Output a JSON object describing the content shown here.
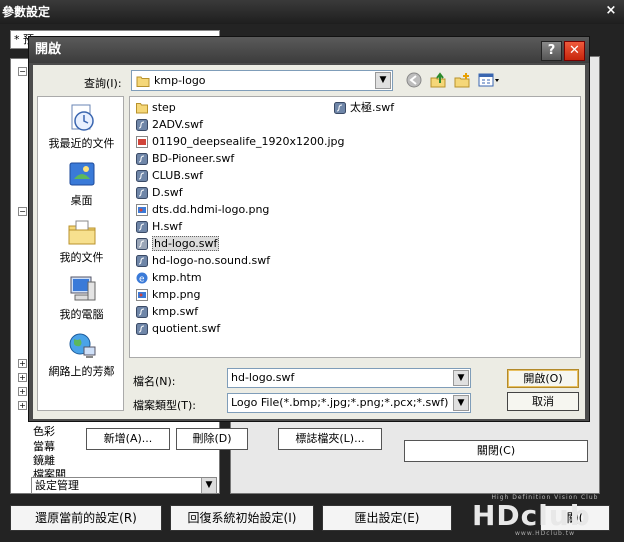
{
  "settings_window": {
    "title": "參數設定",
    "close_glyph": "×",
    "preset_value": "* 預",
    "tree_items": [
      "色彩",
      "當幕",
      "鏡離",
      "檔案關"
    ],
    "tree_combo_value": "設定管理",
    "buttons": {
      "add": "新增(A)...",
      "delete": "刪除(D)",
      "logo_folder": "標誌檔夾(L)...",
      "close": "關閉(C)",
      "restore_current": "還原當前的設定(R)",
      "restore_default": "回復系統初始設定(I)",
      "export": "匯出設定(E)",
      "partial": "關("
    }
  },
  "watermark": {
    "sub": "High Definition Vision Club",
    "big": "HDclub",
    "url": "www.HDclub.tw"
  },
  "open_dialog": {
    "title": "開啟",
    "help_glyph": "?",
    "close_glyph": "✕",
    "look_in_label": "查詢(I):",
    "look_in_value": "kmp-logo",
    "places": [
      {
        "label": "我最近的文件",
        "icon": "recent-documents-icon"
      },
      {
        "label": "桌面",
        "icon": "desktop-icon"
      },
      {
        "label": "我的文件",
        "icon": "my-documents-icon"
      },
      {
        "label": "我的電腦",
        "icon": "my-computer-icon"
      },
      {
        "label": "網路上的芳鄰",
        "icon": "network-places-icon"
      }
    ],
    "files_col1": [
      {
        "name": "step",
        "type": "folder"
      },
      {
        "name": "2ADV.swf",
        "type": "swf"
      },
      {
        "name": "01190_deepsealife_1920x1200.jpg",
        "type": "image"
      },
      {
        "name": "BD-Pioneer.swf",
        "type": "swf"
      },
      {
        "name": "CLUB.swf",
        "type": "swf"
      },
      {
        "name": "D.swf",
        "type": "swf"
      },
      {
        "name": "dts.dd.hdmi-logo.png",
        "type": "image"
      },
      {
        "name": "H.swf",
        "type": "swf"
      },
      {
        "name": "hd-logo.swf",
        "type": "swf",
        "selected": true
      },
      {
        "name": "hd-logo-no.sound.swf",
        "type": "swf"
      },
      {
        "name": "kmp.htm",
        "type": "html"
      },
      {
        "name": "kmp.png",
        "type": "image"
      },
      {
        "name": "kmp.swf",
        "type": "swf"
      },
      {
        "name": "quotient.swf",
        "type": "swf"
      }
    ],
    "files_col2": [
      {
        "name": "太極.swf",
        "type": "swf"
      }
    ],
    "filename_label": "檔名(N):",
    "filename_value": "hd-logo.swf",
    "filetype_label": "檔案類型(T):",
    "filetype_value": "Logo File(*.bmp;*.jpg;*.png;*.pcx;*.swf)",
    "open_button": "開啟(O)",
    "cancel_button": "取消"
  },
  "colors": {
    "title_bar": "#3c3c3c",
    "close_red": "#d8341a",
    "dialog_body": "#ecece4",
    "default_button_border": "#b38a2a"
  }
}
